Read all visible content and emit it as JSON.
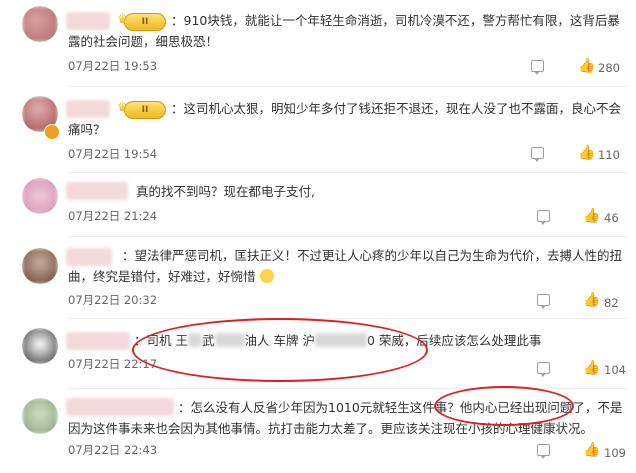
{
  "comments": [
    {
      "text": "：910块钱，就能让一个年轻生命消逝，司机冷漠不还，警方帮忙有限，这背后暴露的社会问题，细思极恐！",
      "time": "07月22日 19:53",
      "likes": "280",
      "vip_level": "II"
    },
    {
      "text": "：这司机心太狠，明知少年多付了钱还拒不退还，现在人没了也不露面，良心不会痛吗？",
      "time": "07月22日 19:54",
      "likes": "110",
      "vip_level": "II"
    },
    {
      "text": "真的找不到吗？现在都电子支付,",
      "time": "07月22日 21:24",
      "likes": "46"
    },
    {
      "text": "：望法律严惩司机，匡扶正义！不过更让人心疼的少年以自己为生命为代价，去搏人性的扭曲，终究是错付，好难过，好惋惜",
      "time": "07月22日 20:32",
      "likes": "82"
    },
    {
      "text_a": "：司机 王",
      "text_b": "武",
      "text_c": "油人 车牌 沪",
      "text_d": "0 荣威，后续应该怎么处理此事",
      "time": "07月22日 22:17",
      "likes": "104"
    },
    {
      "text_a": "：怎么没有人反省少年因为1010元就轻生这件事？",
      "text_b": "他内心已经出现问题了",
      "text_c": "，不是因为这件事未来也会因为其他事情。抗打击能力太差了。更应该关注现在小孩的心理健康状况。",
      "time": "07月22日 22:43",
      "likes": "109"
    }
  ],
  "colors": {
    "highlight_oval": "#e02020",
    "vip_gold": "#f0b81e"
  },
  "icons": [
    "avatar",
    "vip-badge-icon",
    "reply-icon",
    "like-icon",
    "crying-emoji-icon"
  ]
}
